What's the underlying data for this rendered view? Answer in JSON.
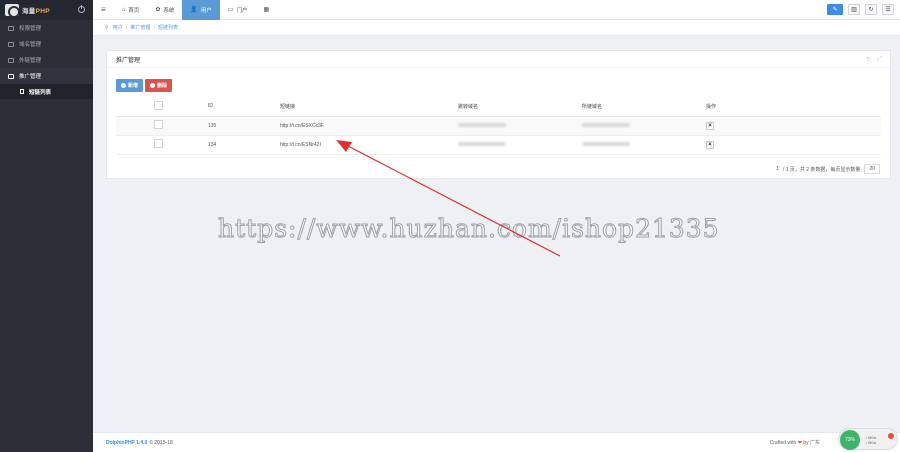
{
  "brand": {
    "name_white": "海量",
    "name_accent": "PHP"
  },
  "sidebar": {
    "items": [
      {
        "label": "权限管理",
        "icon": "user-icon"
      },
      {
        "label": "域名管理",
        "icon": "monitor-icon"
      },
      {
        "label": "外链管理",
        "icon": "link-icon"
      },
      {
        "label": "推广管理",
        "icon": "list-icon",
        "open": true
      }
    ],
    "submenu": [
      {
        "label": "短链列表",
        "active": true
      }
    ]
  },
  "topnav": {
    "items": [
      {
        "label": "首页",
        "glyph": "⌂",
        "active": false
      },
      {
        "label": "系统",
        "glyph": "✿",
        "active": false
      },
      {
        "label": "用户",
        "glyph": "👤",
        "active": true
      },
      {
        "label": "门户",
        "glyph": "▭",
        "active": false
      },
      {
        "label": "",
        "glyph": "▦",
        "active": false
      }
    ]
  },
  "breadcrumb": [
    "用户",
    "推广管理",
    "短链列表"
  ],
  "panel": {
    "title": "推广管理",
    "add_label": "新增",
    "delete_label": "删除",
    "columns": [
      "ID",
      "短链接",
      "跳转域名",
      "所链域名",
      "操作"
    ],
    "rows": [
      {
        "id": "135",
        "short": "http://t.cn/ESXCc3F",
        "action": "×"
      },
      {
        "id": "134",
        "short": "http://t.cn/ESNr42I",
        "action": "×"
      }
    ],
    "pager": {
      "page": "1",
      "summary": "/ 1 页，共 2 条数据，每页显示数量",
      "per_page": "20"
    }
  },
  "watermark": "https://www.huzhan.com/ishop21335",
  "footer": {
    "product": "DolphinPHP 1.4.0",
    "copyright": "© 2015-18",
    "credit_prefix": "Crafted with",
    "credit_suffix": "by 广东"
  },
  "widget": {
    "speed": "73%",
    "line1": "↑ 0K/s",
    "line2": "↓ 0K/s"
  },
  "colors": {
    "accent": "#5b9bd5",
    "danger": "#d9534f",
    "sidebar": "#2b2f38",
    "arrow": "#e03030"
  }
}
